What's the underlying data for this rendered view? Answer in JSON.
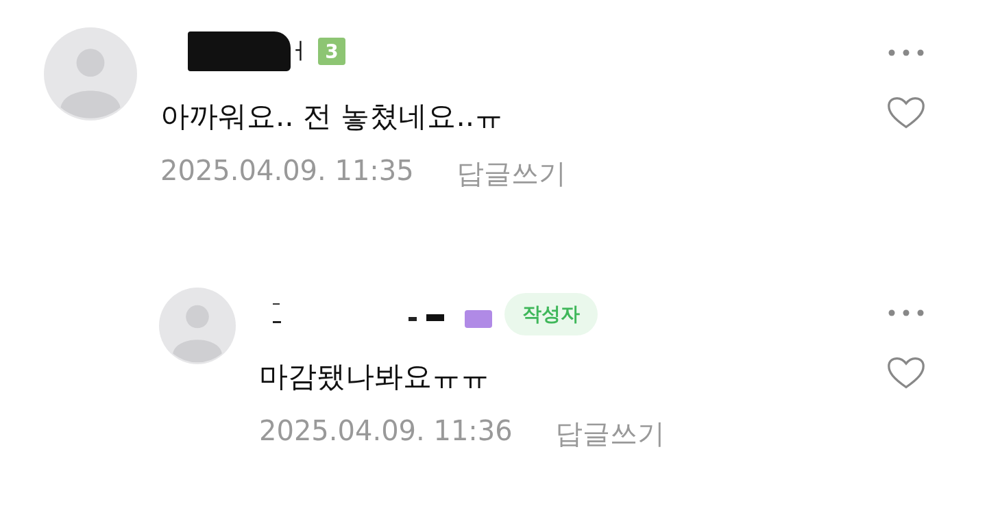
{
  "comments": [
    {
      "kind": "comment",
      "author": {
        "kind": "blacked",
        "visible_part": "ㅓ"
      },
      "level_badge": {
        "label": "3",
        "color": "#8dc573"
      },
      "text": "아까워요.. 전 놓쳤네요..ㅠ",
      "date": "2025.04.09. 11:35",
      "reply_label": "답글쓰기",
      "liked": false
    },
    {
      "kind": "reply",
      "author": {
        "kind": "erased"
      },
      "level_badge": {
        "color": "#b08ae6"
      },
      "writer_badge": "작성자",
      "text": "마감됐나봐요ㅠㅠ",
      "date": "2025.04.09. 11:36",
      "reply_label": "답글쓰기",
      "liked": false
    }
  ]
}
